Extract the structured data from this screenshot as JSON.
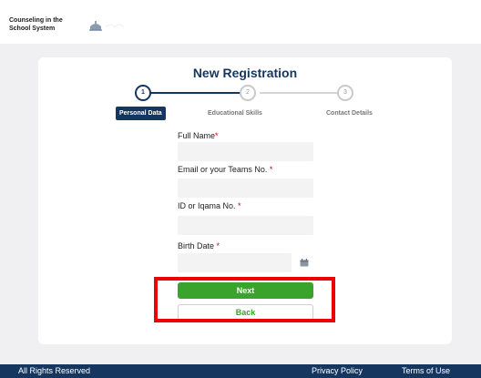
{
  "header": {
    "brand_line1": "Counseling in the",
    "brand_line2": "School System",
    "logo_icon": "mosque-logo-icon"
  },
  "form": {
    "title": "New Registration",
    "steps": [
      {
        "number": "1",
        "label": "Personal Data",
        "state": "active"
      },
      {
        "number": "2",
        "label": "Educational  Skills",
        "state": "pending"
      },
      {
        "number": "3",
        "label": "Contact Details",
        "state": "pending"
      }
    ],
    "fields": [
      {
        "label": "Full Name",
        "required_mark": "*",
        "value": ""
      },
      {
        "label": "Email or your Teams No. ",
        "required_mark": "*",
        "value": ""
      },
      {
        "label": "ID or Iqama No. ",
        "required_mark": "*",
        "value": ""
      },
      {
        "label": "Birth Date ",
        "required_mark": "*",
        "value": ""
      }
    ],
    "date_icon": "calendar-icon",
    "next_label": "Next",
    "back_label": "Back"
  },
  "footer": {
    "rights": "All Rights Reserved",
    "privacy": "Privacy Policy",
    "terms": "Terms of Use"
  },
  "colors": {
    "primary": "#15375f",
    "success": "#3aa32b",
    "required": "#d0021b",
    "highlight": "#ee0000"
  }
}
